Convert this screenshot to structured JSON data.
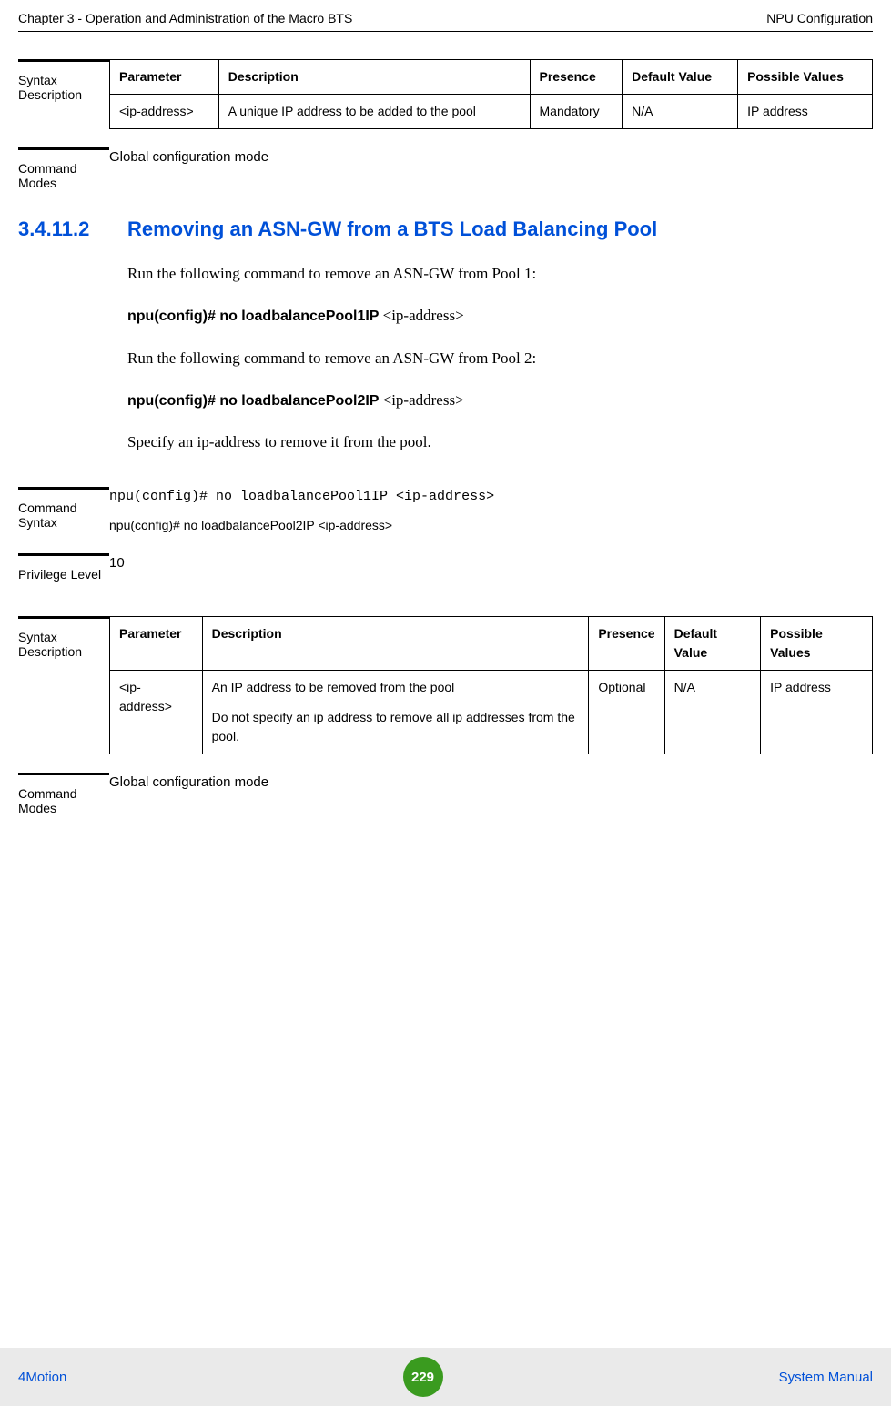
{
  "header": {
    "left": "Chapter 3 - Operation and Administration of the Macro BTS",
    "right": "NPU Configuration"
  },
  "block1": {
    "label": "Syntax Description",
    "table": {
      "headers": [
        "Parameter",
        "Description",
        "Presence",
        "Default Value",
        "Possible Values"
      ],
      "row": {
        "parameter": "<ip-address>",
        "description": "A unique IP address to be added to the pool",
        "presence": "Mandatory",
        "default": "N/A",
        "possible": "IP address"
      }
    }
  },
  "block2": {
    "label": "Command Modes",
    "value": "Global configuration mode"
  },
  "section": {
    "num": "3.4.11.2",
    "title": "Removing an ASN-GW from a BTS Load Balancing Pool",
    "p1": "Run the following command to remove an ASN-GW from Pool 1:",
    "cmd1_bold": "npu(config)# no loadbalancePool1IP ",
    "cmd1_arg": "<ip-address>",
    "p2": "Run the following command to remove an ASN-GW from Pool 2:",
    "cmd2_bold": "npu(config)# no loadbalancePool2IP ",
    "cmd2_arg": "<ip-address>",
    "p3": "Specify an ip-address to remove it from the pool."
  },
  "block3": {
    "label": "Command Syntax",
    "line1": "npu(config)# no loadbalancePool1IP <ip-address>",
    "line2": "npu(config)# no loadbalancePool2IP <ip-address>"
  },
  "block4": {
    "label": "Privilege Level",
    "value": "10"
  },
  "block5": {
    "label": "Syntax Description",
    "table": {
      "headers": [
        "Parameter",
        "Description",
        "Presence",
        "Default Value",
        "Possible Values"
      ],
      "row": {
        "parameter": "<ip-address>",
        "description_p1": "An IP address to be removed from the pool",
        "description_p2": "Do not specify an ip address to remove all ip addresses from the pool.",
        "presence": "Optional",
        "default": "N/A",
        "possible": "IP address"
      }
    }
  },
  "block6": {
    "label": "Command Modes",
    "value": "Global configuration mode"
  },
  "footer": {
    "left": "4Motion",
    "page": "229",
    "right": "System Manual"
  }
}
